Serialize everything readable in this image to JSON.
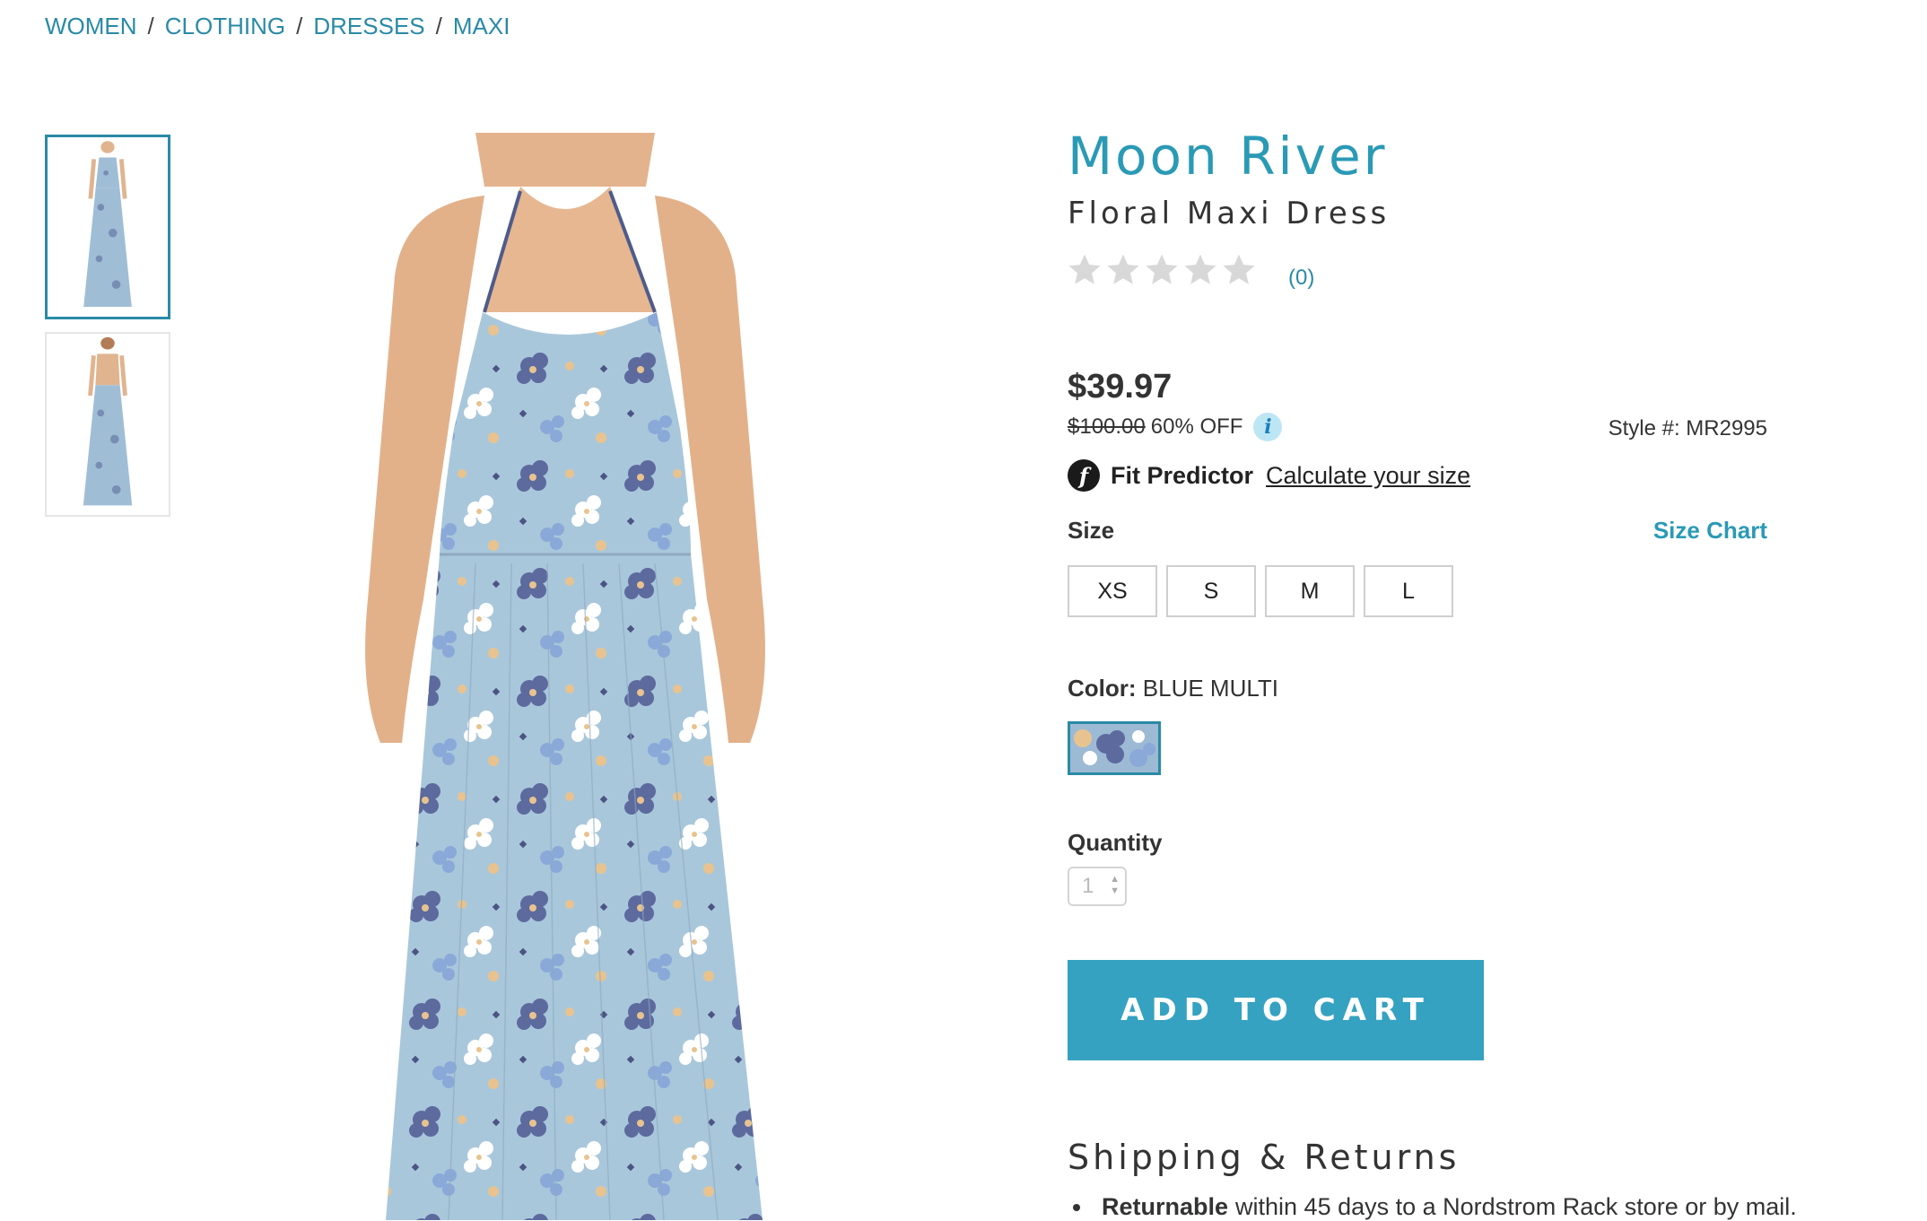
{
  "breadcrumb": [
    "WOMEN",
    "CLOTHING",
    "DRESSES",
    "MAXI"
  ],
  "breadcrumb_separator": "/",
  "product": {
    "brand": "Moon River",
    "name": "Floral Maxi Dress",
    "rating": 0,
    "review_count": "(0)",
    "price": "$39.97",
    "original_price": "$100.00",
    "discount": "60% OFF",
    "style_number": "Style #: MR2995"
  },
  "fit_predictor": {
    "label": "Fit Predictor",
    "link": "Calculate your size"
  },
  "size": {
    "label": "Size",
    "chart_link": "Size Chart",
    "options": [
      "XS",
      "S",
      "M",
      "L"
    ]
  },
  "color": {
    "label": "Color:",
    "value": "BLUE MULTI"
  },
  "quantity": {
    "label": "Quantity",
    "value": "1"
  },
  "add_to_cart": "ADD TO CART",
  "shipping": {
    "title": "Shipping & Returns",
    "returnable_bold": "Returnable",
    "returnable_text": "within 45 days to a Nordstrom Rack store or by mail."
  },
  "colors": {
    "accent": "#2a9ab5",
    "cart_button": "#35a2c1",
    "star_empty": "#d8d8d8"
  }
}
